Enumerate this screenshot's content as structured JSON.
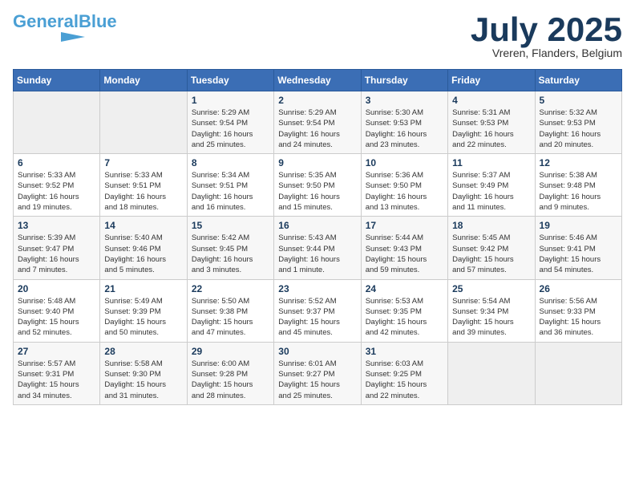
{
  "logo": {
    "part1": "General",
    "part2": "Blue"
  },
  "title": "July 2025",
  "subtitle": "Vreren, Flanders, Belgium",
  "days_of_week": [
    "Sunday",
    "Monday",
    "Tuesday",
    "Wednesday",
    "Thursday",
    "Friday",
    "Saturday"
  ],
  "weeks": [
    [
      {
        "day": "",
        "info": ""
      },
      {
        "day": "",
        "info": ""
      },
      {
        "day": "1",
        "info": "Sunrise: 5:29 AM\nSunset: 9:54 PM\nDaylight: 16 hours\nand 25 minutes."
      },
      {
        "day": "2",
        "info": "Sunrise: 5:29 AM\nSunset: 9:54 PM\nDaylight: 16 hours\nand 24 minutes."
      },
      {
        "day": "3",
        "info": "Sunrise: 5:30 AM\nSunset: 9:53 PM\nDaylight: 16 hours\nand 23 minutes."
      },
      {
        "day": "4",
        "info": "Sunrise: 5:31 AM\nSunset: 9:53 PM\nDaylight: 16 hours\nand 22 minutes."
      },
      {
        "day": "5",
        "info": "Sunrise: 5:32 AM\nSunset: 9:53 PM\nDaylight: 16 hours\nand 20 minutes."
      }
    ],
    [
      {
        "day": "6",
        "info": "Sunrise: 5:33 AM\nSunset: 9:52 PM\nDaylight: 16 hours\nand 19 minutes."
      },
      {
        "day": "7",
        "info": "Sunrise: 5:33 AM\nSunset: 9:51 PM\nDaylight: 16 hours\nand 18 minutes."
      },
      {
        "day": "8",
        "info": "Sunrise: 5:34 AM\nSunset: 9:51 PM\nDaylight: 16 hours\nand 16 minutes."
      },
      {
        "day": "9",
        "info": "Sunrise: 5:35 AM\nSunset: 9:50 PM\nDaylight: 16 hours\nand 15 minutes."
      },
      {
        "day": "10",
        "info": "Sunrise: 5:36 AM\nSunset: 9:50 PM\nDaylight: 16 hours\nand 13 minutes."
      },
      {
        "day": "11",
        "info": "Sunrise: 5:37 AM\nSunset: 9:49 PM\nDaylight: 16 hours\nand 11 minutes."
      },
      {
        "day": "12",
        "info": "Sunrise: 5:38 AM\nSunset: 9:48 PM\nDaylight: 16 hours\nand 9 minutes."
      }
    ],
    [
      {
        "day": "13",
        "info": "Sunrise: 5:39 AM\nSunset: 9:47 PM\nDaylight: 16 hours\nand 7 minutes."
      },
      {
        "day": "14",
        "info": "Sunrise: 5:40 AM\nSunset: 9:46 PM\nDaylight: 16 hours\nand 5 minutes."
      },
      {
        "day": "15",
        "info": "Sunrise: 5:42 AM\nSunset: 9:45 PM\nDaylight: 16 hours\nand 3 minutes."
      },
      {
        "day": "16",
        "info": "Sunrise: 5:43 AM\nSunset: 9:44 PM\nDaylight: 16 hours\nand 1 minute."
      },
      {
        "day": "17",
        "info": "Sunrise: 5:44 AM\nSunset: 9:43 PM\nDaylight: 15 hours\nand 59 minutes."
      },
      {
        "day": "18",
        "info": "Sunrise: 5:45 AM\nSunset: 9:42 PM\nDaylight: 15 hours\nand 57 minutes."
      },
      {
        "day": "19",
        "info": "Sunrise: 5:46 AM\nSunset: 9:41 PM\nDaylight: 15 hours\nand 54 minutes."
      }
    ],
    [
      {
        "day": "20",
        "info": "Sunrise: 5:48 AM\nSunset: 9:40 PM\nDaylight: 15 hours\nand 52 minutes."
      },
      {
        "day": "21",
        "info": "Sunrise: 5:49 AM\nSunset: 9:39 PM\nDaylight: 15 hours\nand 50 minutes."
      },
      {
        "day": "22",
        "info": "Sunrise: 5:50 AM\nSunset: 9:38 PM\nDaylight: 15 hours\nand 47 minutes."
      },
      {
        "day": "23",
        "info": "Sunrise: 5:52 AM\nSunset: 9:37 PM\nDaylight: 15 hours\nand 45 minutes."
      },
      {
        "day": "24",
        "info": "Sunrise: 5:53 AM\nSunset: 9:35 PM\nDaylight: 15 hours\nand 42 minutes."
      },
      {
        "day": "25",
        "info": "Sunrise: 5:54 AM\nSunset: 9:34 PM\nDaylight: 15 hours\nand 39 minutes."
      },
      {
        "day": "26",
        "info": "Sunrise: 5:56 AM\nSunset: 9:33 PM\nDaylight: 15 hours\nand 36 minutes."
      }
    ],
    [
      {
        "day": "27",
        "info": "Sunrise: 5:57 AM\nSunset: 9:31 PM\nDaylight: 15 hours\nand 34 minutes."
      },
      {
        "day": "28",
        "info": "Sunrise: 5:58 AM\nSunset: 9:30 PM\nDaylight: 15 hours\nand 31 minutes."
      },
      {
        "day": "29",
        "info": "Sunrise: 6:00 AM\nSunset: 9:28 PM\nDaylight: 15 hours\nand 28 minutes."
      },
      {
        "day": "30",
        "info": "Sunrise: 6:01 AM\nSunset: 9:27 PM\nDaylight: 15 hours\nand 25 minutes."
      },
      {
        "day": "31",
        "info": "Sunrise: 6:03 AM\nSunset: 9:25 PM\nDaylight: 15 hours\nand 22 minutes."
      },
      {
        "day": "",
        "info": ""
      },
      {
        "day": "",
        "info": ""
      }
    ]
  ]
}
